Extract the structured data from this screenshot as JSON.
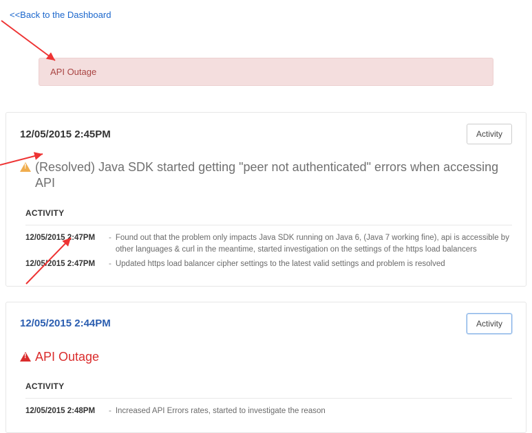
{
  "back_link": "<<Back to the Dashboard",
  "alert_bar": {
    "text": "API Outage"
  },
  "activity_button_label": "Activity",
  "section_label": "ACTIVITY",
  "incidents": [
    {
      "timestamp": "12/05/2015 2:45PM",
      "title": "(Resolved) Java SDK started getting \"peer not authenticated\" errors when accessing API",
      "severity": "warn",
      "button_active": false,
      "header_color": "default",
      "logs": [
        {
          "ts": "12/05/2015 2:47PM",
          "msg": "Found out that the problem only impacts Java SDK running on Java 6, (Java 7 working fine), api is accessible by other languages & curl in the meantime, started investigation on the settings of the https load balancers"
        },
        {
          "ts": "12/05/2015 2:47PM",
          "msg": "Updated https load balancer cipher settings to the latest valid settings and problem is resolved"
        }
      ]
    },
    {
      "timestamp": "12/05/2015 2:44PM",
      "title": "API Outage",
      "severity": "danger",
      "button_active": true,
      "header_color": "blue",
      "logs": [
        {
          "ts": "12/05/2015 2:48PM",
          "msg": "Increased API Errors rates, started to investigate the reason"
        }
      ]
    }
  ]
}
